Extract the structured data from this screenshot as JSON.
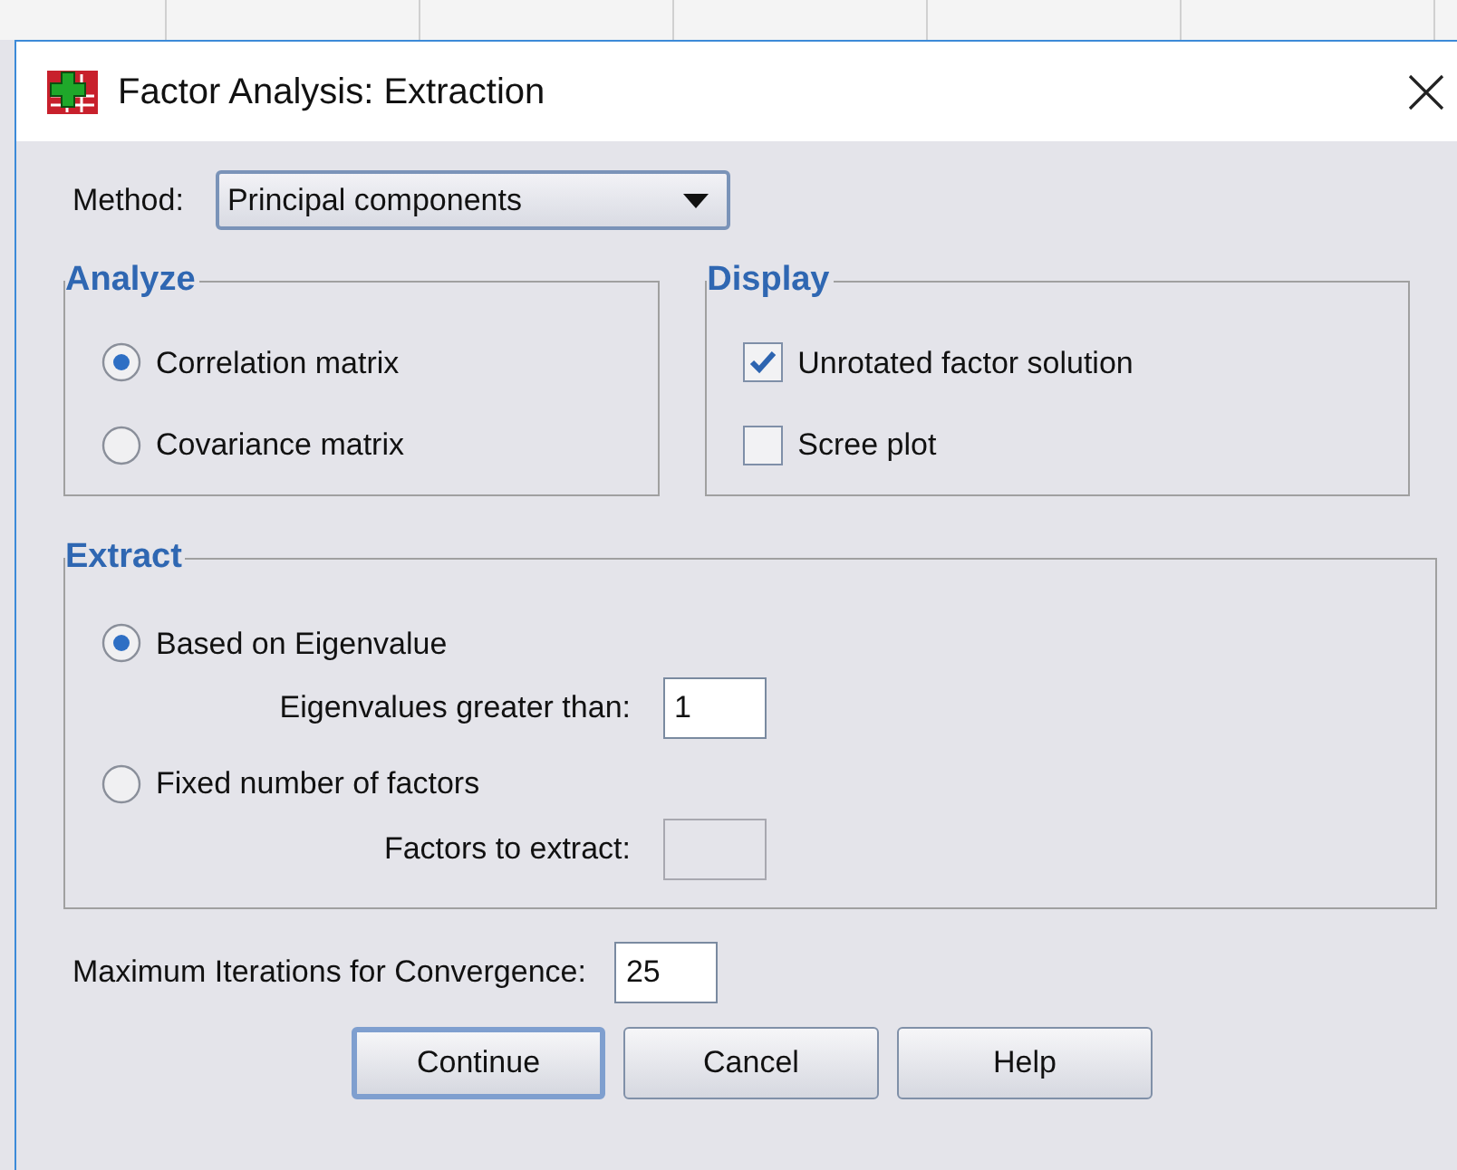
{
  "window": {
    "title": "Factor Analysis: Extraction"
  },
  "method": {
    "label": "Method:",
    "value": "Principal components"
  },
  "analyze": {
    "title": "Analyze",
    "options": [
      {
        "label": "Correlation matrix",
        "selected": true
      },
      {
        "label": "Covariance matrix",
        "selected": false
      }
    ]
  },
  "display": {
    "title": "Display",
    "options": [
      {
        "label": "Unrotated factor solution",
        "checked": true
      },
      {
        "label": "Scree plot",
        "checked": false
      }
    ]
  },
  "extract": {
    "title": "Extract",
    "options": [
      {
        "label": "Based on Eigenvalue",
        "selected": true,
        "field": {
          "label": "Eigenvalues greater than:",
          "value": "1",
          "disabled": false
        }
      },
      {
        "label": "Fixed number of factors",
        "selected": false,
        "field": {
          "label": "Factors to extract:",
          "disabled": true
        }
      }
    ]
  },
  "max_iterations": {
    "label": "Maximum Iterations for Convergence:",
    "value": "25"
  },
  "buttons": [
    {
      "label": "Continue",
      "default": true
    },
    {
      "label": "Cancel",
      "default": false
    },
    {
      "label": "Help",
      "default": false
    }
  ]
}
